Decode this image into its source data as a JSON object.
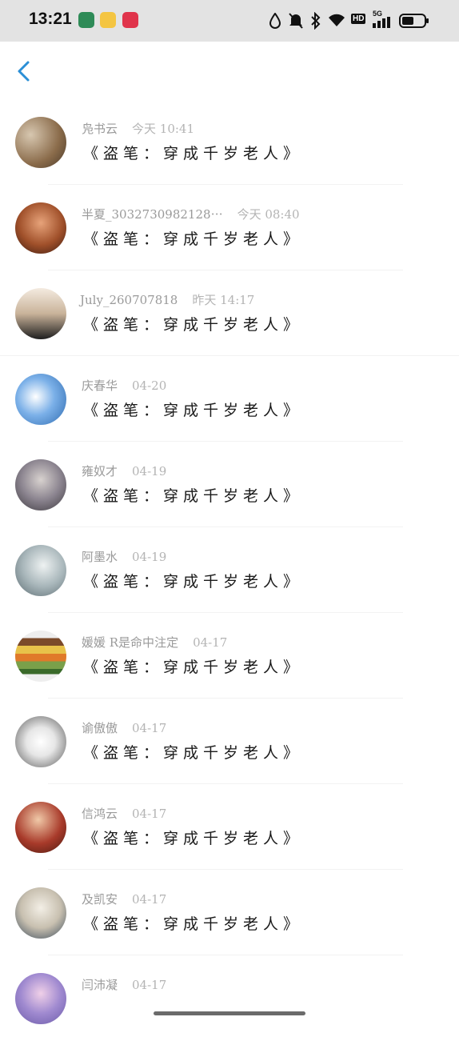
{
  "status_bar": {
    "time": "13:21",
    "network_badge": "HD",
    "signal_label": "5G"
  },
  "nav": {
    "back_icon": "chevron-left-icon"
  },
  "comments": [
    {
      "name": "凫书云",
      "date": "今天 10:41",
      "title": "《盗笔：穿成千岁老人》",
      "avatar_color": "#8a6b4a"
    },
    {
      "name": "半夏_3032730982128⋯",
      "date": "今天 08:40",
      "title": "《盗笔：穿成千岁老人》",
      "avatar_color": "#a0502a"
    },
    {
      "name": "July_260707818",
      "date": "昨天 14:17",
      "title": "《盗笔：穿成千岁老人》",
      "avatar_color": "#c9b39a"
    },
    {
      "name": "庆春华",
      "date": "04-20",
      "title": "《盗笔：穿成千岁老人》",
      "avatar_color": "#4a86c8"
    },
    {
      "name": "雍奴才",
      "date": "04-19",
      "title": "《盗笔：穿成千岁老人》",
      "avatar_color": "#6b6670"
    },
    {
      "name": "阿墨水",
      "date": "04-19",
      "title": "《盗笔：穿成千岁老人》",
      "avatar_color": "#8c9aa0"
    },
    {
      "name": "媛媛 R是命中注定",
      "date": "04-17",
      "title": "《盗笔：穿成千岁老人》",
      "avatar_color": "#e8e8e8"
    },
    {
      "name": "谕傲傲",
      "date": "04-17",
      "title": "《盗笔：穿成千岁老人》",
      "avatar_color": "#5a5a5a"
    },
    {
      "name": "信鸿云",
      "date": "04-17",
      "title": "《盗笔：穿成千岁老人》",
      "avatar_color": "#a83a2a"
    },
    {
      "name": "及凯安",
      "date": "04-17",
      "title": "《盗笔：穿成千岁老人》",
      "avatar_color": "#c8c0b0"
    },
    {
      "name": "闫沛凝",
      "date": "04-17",
      "title": "",
      "avatar_color": "#6a5aa8"
    }
  ]
}
